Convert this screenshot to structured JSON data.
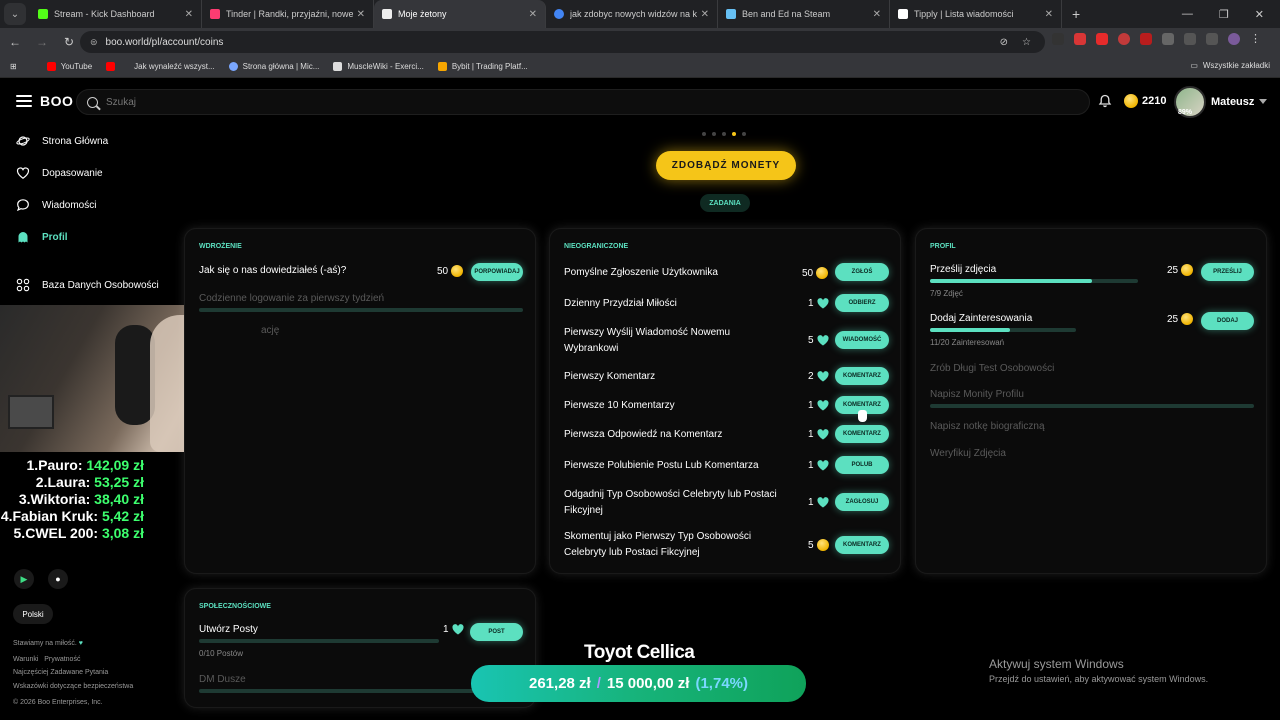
{
  "browser": {
    "tabs": [
      {
        "title": "Stream - Kick Dashboard",
        "color": "#53fc18"
      },
      {
        "title": "Tinder | Randki, przyjaźni, nowe",
        "color": "#fe3c72"
      },
      {
        "title": "Moje żetony",
        "color": "#eeeeee"
      },
      {
        "title": "jak zdobyc nowych widzów na k",
        "color": "#4285f4"
      },
      {
        "title": "Ben and Ed na Steam",
        "color": "#66c0f4"
      },
      {
        "title": "Tipply | Lista wiadomości",
        "color": "#ffffff"
      }
    ],
    "new_tab": "+",
    "url": "boo.world/pl/account/coins",
    "bookmarks": [
      {
        "label": "YouTube",
        "color": "#ff0000"
      },
      {
        "label": "",
        "color": "#ff0000"
      },
      {
        "label": "Jak wynaleźć wszyst...",
        "color": "#888888"
      },
      {
        "label": "Strona główna | Mic...",
        "color": "#7aa7ff"
      },
      {
        "label": "MuscleWiki - Exerci...",
        "color": "#dddddd"
      },
      {
        "label": "Bybit | Trading Platf...",
        "color": "#f7a600"
      }
    ],
    "bookmarks_all": "Wszystkie zakładki"
  },
  "header": {
    "logo": "BOO",
    "search_placeholder": "Szukaj",
    "coins": "2210",
    "avatar_pct": "89%",
    "username": "Mateusz"
  },
  "sidebar": {
    "items": [
      {
        "label": "Strona Główna",
        "icon": "planet-icon"
      },
      {
        "label": "Dopasowanie",
        "icon": "heart-icon"
      },
      {
        "label": "Wiadomości",
        "icon": "chat-icon"
      },
      {
        "label": "Profil",
        "icon": "profile-icon"
      },
      {
        "label": "Baza Danych Osobowości",
        "icon": "database-icon"
      }
    ],
    "language": "Polski",
    "footer": {
      "tagline": "Stawiamy na miłość.",
      "links1": [
        "Warunki",
        "Prywatność"
      ],
      "faq": "Najczęściej Zadawane Pytania",
      "safety": "Wskazówki dotyczące bezpieczeństwa",
      "copyright": "© 2026 Boo Enterprises, Inc."
    }
  },
  "leaderboard": [
    {
      "rank": "1.",
      "name": "Pauro:",
      "amount": "142,09 zł"
    },
    {
      "rank": "2.",
      "name": "Laura:",
      "amount": "53,25 zł"
    },
    {
      "rank": "3.",
      "name": "Wiktoria:",
      "amount": "38,40 zł"
    },
    {
      "rank": "4.",
      "name": "Fabian Kruk:",
      "amount": "5,42 zł"
    },
    {
      "rank": "5.",
      "name": "CWEL 200:",
      "amount": "3,08 zł"
    }
  ],
  "main": {
    "get_coins_button": "ZDOBĄDŹ MONETY",
    "tasks_chip": "ZADANIA",
    "onboarding": {
      "title": "WDROŻENIE",
      "q1": "Jak się o nas dowiedziałeś (-aś)?",
      "q1_reward": "50",
      "q1_button": "PORPOWIADAJ",
      "dim1": "Codzienne logowanie za pierwszy tydzień",
      "dim2": "ację"
    },
    "unlimited": {
      "title": "NIEOGRANICZONE",
      "tasks": [
        {
          "label": "Pomyślne Zgłoszenie Użytkownika",
          "reward": "50",
          "type": "coin",
          "button": "ZGŁOŚ"
        },
        {
          "label": "Dzienny Przydział Miłości",
          "reward": "1",
          "type": "gem",
          "button": "ODBIERZ"
        },
        {
          "label": "Pierwszy Wyślij Wiadomość Nowemu",
          "label2": "Wybrankowi",
          "reward": "5",
          "type": "gem",
          "button": "WIADOMOŚĆ"
        },
        {
          "label": "Pierwszy Komentarz",
          "reward": "2",
          "type": "gem",
          "button": "KOMENTARZ"
        },
        {
          "label": "Pierwsze 10 Komentarzy",
          "reward": "1",
          "type": "gem",
          "button": "KOMENTARZ"
        },
        {
          "label": "Pierwsza Odpowiedź na Komentarz",
          "reward": "1",
          "type": "gem",
          "button": "KOMENTARZ"
        },
        {
          "label": "Pierwsze Polubienie Postu Lub Komentarza",
          "reward": "1",
          "type": "gem",
          "button": "POLUB"
        },
        {
          "label": "Odgadnij Typ Osobowości Celebryty lub Postaci",
          "label2": "Fikcyjnej",
          "reward": "1",
          "type": "gem",
          "button": "ZAGŁOSUJ"
        },
        {
          "label": "Skomentuj jako Pierwszy Typ Osobowości",
          "label2": "Celebryty lub Postaci Fikcyjnej",
          "reward": "5",
          "type": "coin",
          "button": "KOMENTARZ"
        }
      ]
    },
    "profile": {
      "title": "PROFIL",
      "photos_label": "Prześlij zdjęcia",
      "photos_reward": "25",
      "photos_button": "PRZEŚLIJ",
      "photos_sub": "7/9 Zdjęć",
      "photos_progress": 0.78,
      "interests_label": "Dodaj Zainteresowania",
      "interests_reward": "25",
      "interests_button": "DODAJ",
      "interests_sub": "11/20 Zainteresowań",
      "interests_progress": 0.55,
      "dim1": "Zrób Długi Test Osobowości",
      "dim2": "Napisz Monity Profilu",
      "dim3": "Napisz notkę biograficzną",
      "dim4": "Weryfikuj Zdjęcia"
    },
    "social": {
      "title": "SPOŁECZNOŚCIOWE",
      "posts_label": "Utwórz Posty",
      "posts_reward": "1",
      "posts_button": "POST",
      "posts_sub": "0/10 Postów",
      "dim1": "DM Dusze"
    }
  },
  "overlay": {
    "car_title": "Toyot Cellica",
    "goal_current": "261,28 zł",
    "goal_sep": "/",
    "goal_target": "15 000,00 zł",
    "goal_pct": "(1,74%)",
    "activate_title": "Aktywuj system Windows",
    "activate_sub": "Przejdź do ustawień, aby aktywować system Windows."
  }
}
